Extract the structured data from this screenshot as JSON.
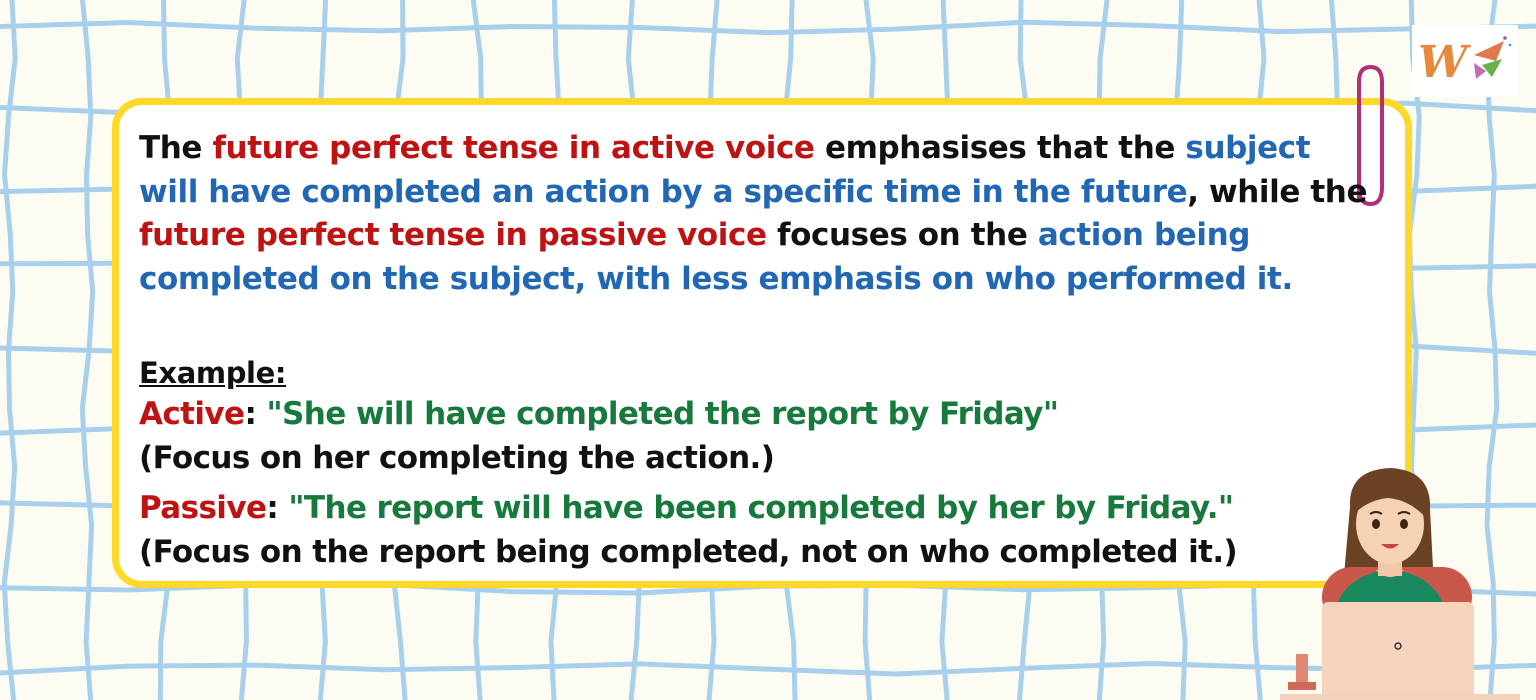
{
  "paragraph": {
    "p1": "The ",
    "p2": "future perfect tense in active voice",
    "p3": " emphasises that the ",
    "p4": "subject will have completed an action by a specific time in the future",
    "p5": ", while the ",
    "p6": "future perfect tense in passive voice",
    "p7": " focuses on the ",
    "p8": "action being completed on the subject, with less emphasis on who performed it."
  },
  "example": {
    "label": "Example:",
    "active_word": "Active",
    "active_colon": ": ",
    "active_sentence": "\"She will have completed the report by Friday\"",
    "active_focus": "(Focus on her completing the action.)",
    "passive_word": "Passive",
    "passive_colon": ": ",
    "passive_sentence": "\"The report will have been completed by her by Friday.\"",
    "passive_focus": "(Focus on the report being completed, not on who completed it.)"
  },
  "colors": {
    "background": "#fdfcf3",
    "grid": "#a8d0ec",
    "card_border": "#ffd829",
    "red": "#bf1212",
    "blue": "#2167b4",
    "green": "#177a3c",
    "clip": "#b0307a"
  },
  "icons": [
    "w-logo-icon",
    "paperclip-icon",
    "woman-with-laptop-illustration"
  ]
}
